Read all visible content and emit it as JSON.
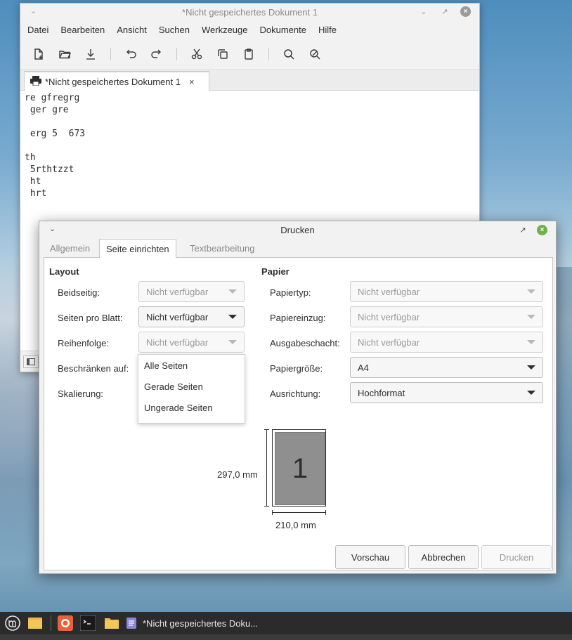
{
  "editor": {
    "title": "*Nicht gespeichertes Dokument 1",
    "menu": [
      "Datei",
      "Bearbeiten",
      "Ansicht",
      "Suchen",
      "Werkzeuge",
      "Dokumente",
      "Hilfe"
    ],
    "tab_label": "*Nicht gespeichertes Dokument 1",
    "tab_close": "×",
    "content": "re gfregrg\n ger gre\n\n erg 5  673\n\nth\n 5rthtzzt\n ht\n hrt"
  },
  "dialog": {
    "title": "Drucken",
    "tabs": [
      "Allgemein",
      "Seite einrichten",
      "Textbearbeitung"
    ],
    "active_tab": "Seite einrichten",
    "layout": {
      "title": "Layout",
      "beidseitig_label": "Beidseitig:",
      "beidseitig_value": "Nicht verfügbar",
      "seiten_pro_blatt_label": "Seiten pro Blatt:",
      "seiten_pro_blatt_value": "Nicht verfügbar",
      "reihenfolge_label": "Reihenfolge:",
      "reihenfolge_value": "Nicht verfügbar",
      "beschraenken_label": "Beschränken auf:",
      "skalierung_label": "Skalierung:",
      "restrict_options": [
        "Alle Seiten",
        "Gerade Seiten",
        "Ungerade Seiten"
      ]
    },
    "papier": {
      "title": "Papier",
      "papiertyp_label": "Papiertyp:",
      "papiertyp_value": "Nicht verfügbar",
      "papiereinzug_label": "Papiereinzug:",
      "papiereinzug_value": "Nicht verfügbar",
      "ausgabeschacht_label": "Ausgabeschacht:",
      "ausgabeschacht_value": "Nicht verfügbar",
      "papiergroesse_label": "Papiergröße:",
      "papiergroesse_value": "A4",
      "ausrichtung_label": "Ausrichtung:",
      "ausrichtung_value": "Hochformat"
    },
    "preview": {
      "page_number": "1",
      "height": "297,0 mm",
      "width": "210,0 mm"
    },
    "buttons": {
      "preview": "Vorschau",
      "cancel": "Abbrechen",
      "print": "Drucken"
    }
  },
  "taskbar": {
    "window_label": "*Nicht gespeichertes Doku..."
  }
}
